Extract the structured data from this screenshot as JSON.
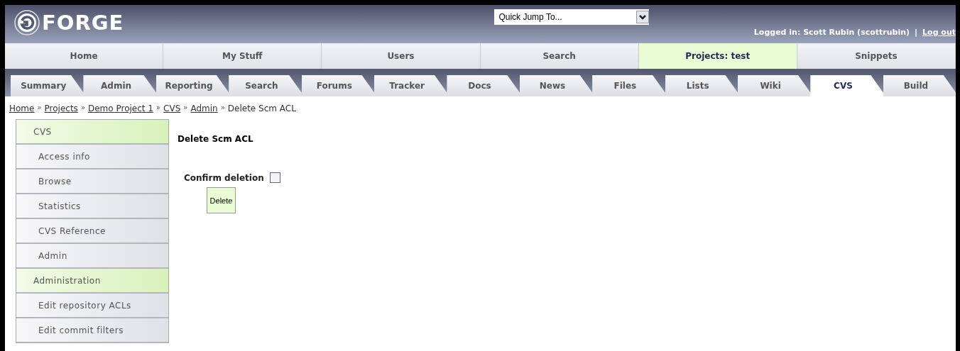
{
  "header": {
    "logo": "FORGE",
    "quick_jump": {
      "value": "Quick Jump To..."
    },
    "user": "Logged in: Scott Rubin (scottrubin)",
    "separator": "|",
    "logout": "Log out"
  },
  "nav": [
    {
      "label": "Home",
      "selected": false
    },
    {
      "label": "My Stuff",
      "selected": false
    },
    {
      "label": "Users",
      "selected": false
    },
    {
      "label": "Search",
      "selected": false
    },
    {
      "label": "Projects: test",
      "selected": true
    },
    {
      "label": "Snippets",
      "selected": false
    }
  ],
  "tabs": [
    {
      "label": "Summary",
      "selected": false
    },
    {
      "label": "Admin",
      "selected": false
    },
    {
      "label": "Reporting",
      "selected": false
    },
    {
      "label": "Search",
      "selected": false
    },
    {
      "label": "Forums",
      "selected": false
    },
    {
      "label": "Tracker",
      "selected": false
    },
    {
      "label": "Docs",
      "selected": false
    },
    {
      "label": "News",
      "selected": false
    },
    {
      "label": "Files",
      "selected": false
    },
    {
      "label": "Lists",
      "selected": false
    },
    {
      "label": "Wiki",
      "selected": false
    },
    {
      "label": "CVS",
      "selected": true
    },
    {
      "label": "Build",
      "selected": false
    }
  ],
  "breadcrumb": {
    "links": [
      "Home",
      "Projects",
      "Demo Project 1",
      "CVS",
      "Admin"
    ],
    "separator": "»",
    "current": "Delete Scm ACL"
  },
  "sidebar": [
    {
      "label": "CVS",
      "kind": "section"
    },
    {
      "label": "Access info",
      "kind": "item"
    },
    {
      "label": "Browse",
      "kind": "item"
    },
    {
      "label": "Statistics",
      "kind": "item"
    },
    {
      "label": "CVS Reference",
      "kind": "item"
    },
    {
      "label": "Admin",
      "kind": "item"
    },
    {
      "label": "Administration",
      "kind": "section"
    },
    {
      "label": "Edit repository ACLs",
      "kind": "item"
    },
    {
      "label": "Edit commit filters",
      "kind": "item"
    }
  ],
  "content": {
    "title": "Delete Scm ACL",
    "confirm": {
      "label": "Confirm deletion",
      "checked": false
    },
    "button": "Delete"
  }
}
